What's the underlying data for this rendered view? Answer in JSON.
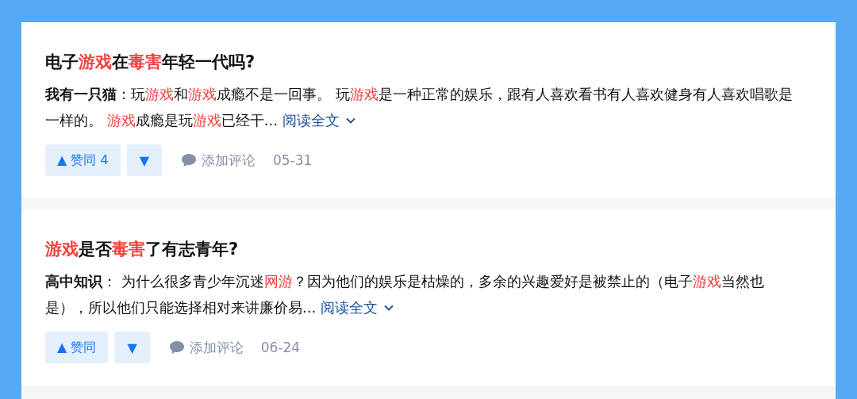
{
  "answers": [
    {
      "title": [
        {
          "kind": "text",
          "text": "电子"
        },
        {
          "kind": "highlight",
          "text": "游戏"
        },
        {
          "kind": "text",
          "text": "在"
        },
        {
          "kind": "highlight",
          "text": "毒害"
        },
        {
          "kind": "text",
          "text": "年轻一代吗?"
        }
      ],
      "excerpt": [
        {
          "kind": "author",
          "text": "我有一只猫"
        },
        {
          "kind": "text",
          "text": "：玩"
        },
        {
          "kind": "highlight",
          "text": "游戏"
        },
        {
          "kind": "text",
          "text": "和"
        },
        {
          "kind": "highlight",
          "text": "游戏"
        },
        {
          "kind": "text",
          "text": "成瘾不是一回事。 玩"
        },
        {
          "kind": "highlight",
          "text": "游戏"
        },
        {
          "kind": "text",
          "text": "是一种正常的娱乐，跟有人喜欢看书有人喜欢健身有人喜欢唱歌是一样的。 "
        },
        {
          "kind": "highlight",
          "text": "游戏"
        },
        {
          "kind": "text",
          "text": "成瘾是玩"
        },
        {
          "kind": "highlight",
          "text": "游戏"
        },
        {
          "kind": "text",
          "text": "已经干..."
        }
      ],
      "read_more": "阅读全文",
      "upvote": "▲ 赞同 4",
      "downvote": "▼",
      "comment": "添加评论",
      "date": "05-31"
    },
    {
      "title": [
        {
          "kind": "highlight",
          "text": "游戏"
        },
        {
          "kind": "text",
          "text": "是否"
        },
        {
          "kind": "highlight",
          "text": "毒害"
        },
        {
          "kind": "text",
          "text": "了有志青年?"
        }
      ],
      "excerpt": [
        {
          "kind": "author",
          "text": "高中知识"
        },
        {
          "kind": "text",
          "text": "： 为什么很多青少年沉迷"
        },
        {
          "kind": "highlight",
          "text": "网游"
        },
        {
          "kind": "text",
          "text": "？因为他们的娱乐是枯燥的，多余的兴趣爱好是被禁止的（电子"
        },
        {
          "kind": "highlight",
          "text": "游戏"
        },
        {
          "kind": "text",
          "text": "当然也是），所以他们只能选择相对来讲廉价易..."
        }
      ],
      "read_more": "阅读全文",
      "upvote": "▲ 赞同",
      "downvote": "▼",
      "comment": "添加评论",
      "date": "06-24"
    }
  ]
}
